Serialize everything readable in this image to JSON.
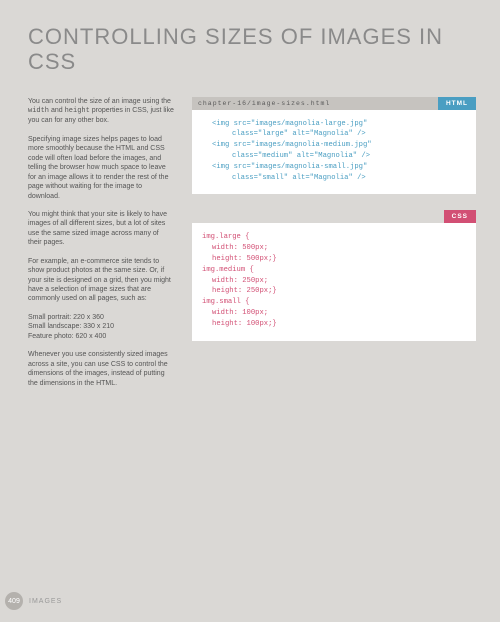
{
  "title": "CONTROLLING SIZES OF IMAGES IN CSS",
  "left": {
    "p1a": "You can control the size of an image using the ",
    "p1b": "width",
    "p1c": " and ",
    "p1d": "height",
    "p1e": " properties in CSS, just like you can for any other box.",
    "p2": "Specifying image sizes helps pages to load more smoothly because the HTML and CSS code will often load before the images, and telling the browser how much space to leave for an image allows it to render the rest of the page without waiting for the image to download.",
    "p3": "You might think that your site is likely to have images of all different sizes, but a lot of sites use the same sized image across many of their pages.",
    "p4": "For example, an e-commerce site tends to show product photos at the same size. Or, if your site is designed on a grid, then you might have a selection of image sizes that are commonly used on all pages, such as:",
    "p5a": "Small portrait: 220 x 360",
    "p5b": "Small landscape: 330 x 210",
    "p5c": "Feature photo: 620 x 400",
    "p6": "Whenever you use consistently sized images across a site, you can use CSS to control the dimensions of the images, instead of putting the dimensions in the HTML."
  },
  "html_block": {
    "path": "chapter-16/image-sizes.html",
    "tag": "HTML",
    "l1": "<img src=\"images/magnolia-large.jpg\"",
    "l2": "class=\"large\" alt=\"Magnolia\" />",
    "l3": "<img src=\"images/magnolia-medium.jpg\"",
    "l4": "class=\"medium\" alt=\"Magnolia\" />",
    "l5": "<img src=\"images/magnolia-small.jpg\"",
    "l6": "class=\"small\" alt=\"Magnolia\" />"
  },
  "css_block": {
    "tag": "CSS",
    "l1": "img.large {",
    "l2": "width: 500px;",
    "l3": "height: 500px;}",
    "l4": "img.medium {",
    "l5": "width: 250px;",
    "l6": "height: 250px;}",
    "l7": "img.small {",
    "l8": "width: 100px;",
    "l9": "height: 100px;}"
  },
  "footer": {
    "page": "409",
    "section": "IMAGES"
  }
}
